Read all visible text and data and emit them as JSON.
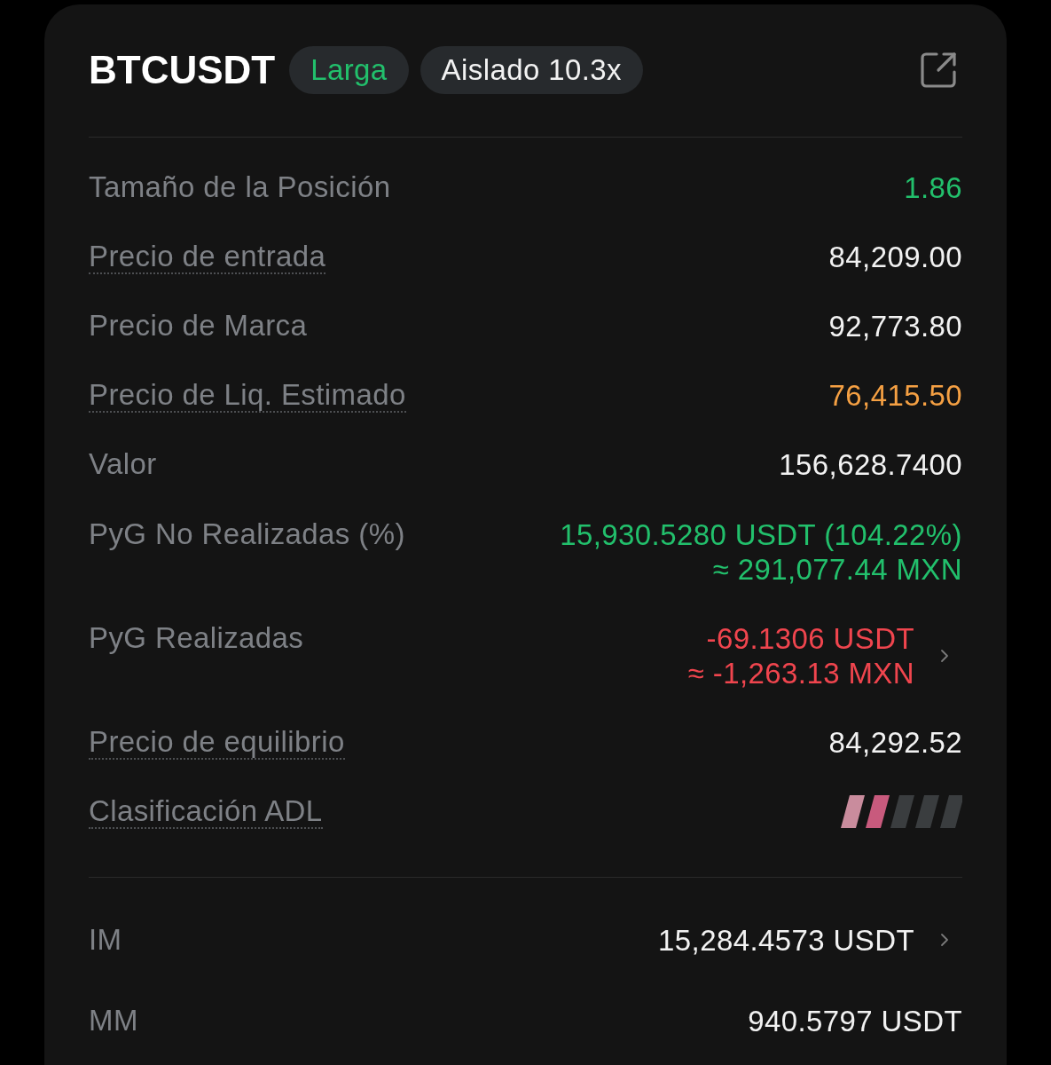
{
  "header": {
    "symbol": "BTCUSDT",
    "badges": [
      {
        "label": "Larga",
        "color": "#22c06c"
      },
      {
        "label": "Aislado 10.3x",
        "color": "#f2f2f2"
      }
    ]
  },
  "details": [
    {
      "kind": "text",
      "label": "Tamaño de la Posición",
      "underlined": false,
      "chevron": false,
      "values": [
        {
          "text": "1.86",
          "color": "#22c06c"
        }
      ]
    },
    {
      "kind": "text",
      "label": "Precio de entrada",
      "underlined": true,
      "chevron": false,
      "values": [
        {
          "text": "84,209.00",
          "color": "#f2f2f2"
        }
      ]
    },
    {
      "kind": "text",
      "label": "Precio de Marca",
      "underlined": false,
      "chevron": false,
      "values": [
        {
          "text": "92,773.80",
          "color": "#f2f2f2"
        }
      ]
    },
    {
      "kind": "text",
      "label": "Precio de Liq. Estimado",
      "underlined": true,
      "chevron": false,
      "values": [
        {
          "text": "76,415.50",
          "color": "#f5a043"
        }
      ]
    },
    {
      "kind": "text",
      "label": "Valor",
      "underlined": false,
      "chevron": false,
      "values": [
        {
          "text": "156,628.7400",
          "color": "#f2f2f2"
        }
      ]
    },
    {
      "kind": "text",
      "label": "PyG No Realizadas (%)",
      "underlined": false,
      "chevron": false,
      "values": [
        {
          "text": "15,930.5280 USDT (104.22%)",
          "color": "#22c06c"
        },
        {
          "text": "≈ 291,077.44 MXN",
          "color": "#22c06c"
        }
      ]
    },
    {
      "kind": "text",
      "label": "PyG Realizadas",
      "underlined": false,
      "chevron": true,
      "values": [
        {
          "text": "-69.1306 USDT",
          "color": "#f0454e"
        },
        {
          "text": "≈ -1,263.13 MXN",
          "color": "#f0454e"
        }
      ]
    },
    {
      "kind": "text",
      "label": "Precio de equilibrio",
      "underlined": true,
      "chevron": false,
      "values": [
        {
          "text": "84,292.52",
          "color": "#f2f2f2"
        }
      ]
    },
    {
      "kind": "meter",
      "label": "Clasificación ADL",
      "underlined": true,
      "chevron": false,
      "level": 0.4
    }
  ],
  "margin": [
    {
      "kind": "text",
      "label": "IM",
      "underlined": false,
      "chevron": true,
      "values": [
        {
          "text": "15,284.4573 USDT",
          "color": "#f2f2f2"
        }
      ]
    },
    {
      "kind": "text",
      "label": "MM",
      "underlined": false,
      "chevron": false,
      "values": [
        {
          "text": "940.5797 USDT",
          "color": "#f2f2f2"
        }
      ]
    }
  ]
}
